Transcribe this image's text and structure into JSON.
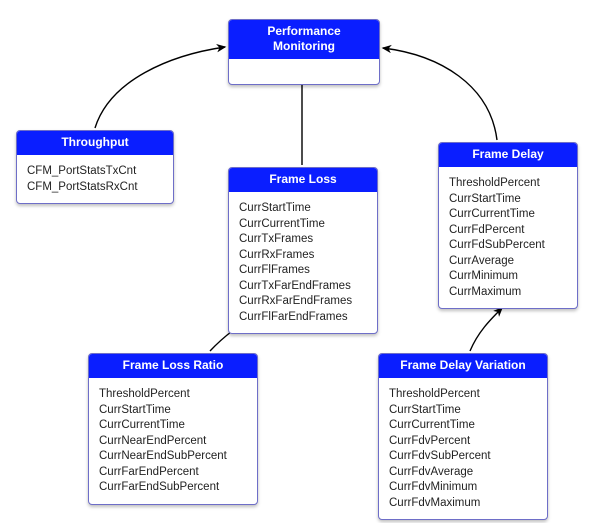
{
  "root": {
    "title": "Performance Monitoring"
  },
  "throughput": {
    "title": "Throughput",
    "items": [
      "CFM_PortStatsTxCnt",
      "CFM_PortStatsRxCnt"
    ]
  },
  "frameLoss": {
    "title": "Frame Loss",
    "items": [
      "CurrStartTime",
      "CurrCurrentTime",
      "CurrTxFrames",
      "CurrRxFrames",
      "CurrFlFrames",
      "CurrTxFarEndFrames",
      "CurrRxFarEndFrames",
      "CurrFlFarEndFrames"
    ]
  },
  "frameDelay": {
    "title": "Frame Delay",
    "items": [
      "ThresholdPercent",
      "CurrStartTime",
      "CurrCurrentTime",
      "CurrFdPercent",
      "CurrFdSubPercent",
      "CurrAverage",
      "CurrMinimum",
      "CurrMaximum"
    ]
  },
  "frameLossRatio": {
    "title": "Frame Loss Ratio",
    "items": [
      "ThresholdPercent",
      "CurrStartTime",
      "CurrCurrentTime",
      "CurrNearEndPercent",
      "CurrNearEndSubPercent",
      "CurrFarEndPercent",
      "CurrFarEndSubPercent"
    ]
  },
  "frameDelayVariation": {
    "title": "Frame Delay Variation",
    "items": [
      "ThresholdPercent",
      "CurrStartTime",
      "CurrCurrentTime",
      "CurrFdvPercent",
      "CurrFdvSubPercent",
      "CurrFdvAverage",
      "CurrFdvMinimum",
      "CurrFdvMaximum"
    ]
  }
}
